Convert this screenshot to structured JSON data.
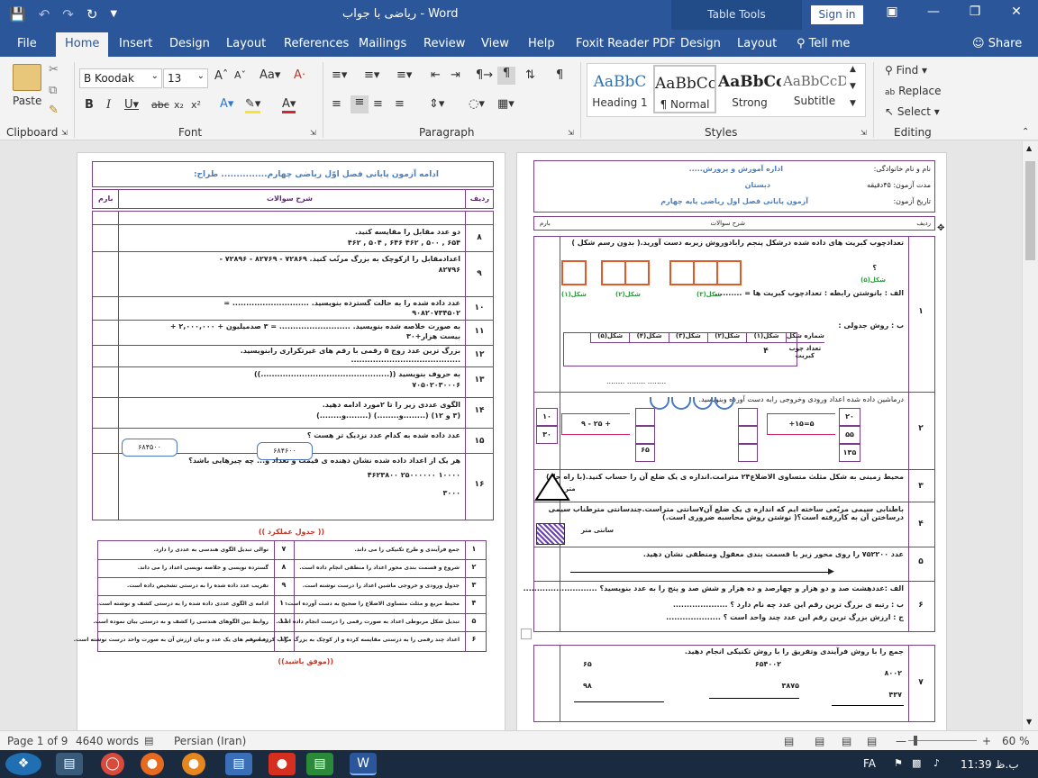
{
  "app": {
    "title": "ریاضی با جواب  -  Word",
    "context_tab": "Table Tools",
    "sign_in": "Sign in",
    "share": "Share",
    "tell_me": "Tell me"
  },
  "tabs": [
    "File",
    "Home",
    "Insert",
    "Design",
    "Layout",
    "References",
    "Mailings",
    "Review",
    "View",
    "Help",
    "Foxit Reader PDF",
    "Design",
    "Layout"
  ],
  "ribbon": {
    "paste": "Paste",
    "font_name": "B Koodak",
    "font_size": "13",
    "groups": {
      "clipboard": "Clipboard",
      "font": "Font",
      "paragraph": "Paragraph",
      "styles": "Styles",
      "editing": "Editing"
    },
    "styles": [
      {
        "sample": "AaBbC",
        "name": "Heading 1"
      },
      {
        "sample": "AaBbCcl",
        "name": "¶ Normal"
      },
      {
        "sample": "AaBbCc",
        "name": "Strong"
      },
      {
        "sample": "AaBbCcD",
        "name": "Subtitle"
      }
    ],
    "editing": {
      "find": "Find",
      "replace": "Replace",
      "select": "Select"
    }
  },
  "status": {
    "page": "Page 1 of 9",
    "words": "4640 words",
    "language": "Persian (Iran)",
    "zoom": "60 %"
  },
  "taskbar": {
    "lang": "FA",
    "time": "11:39 ب.ظ"
  },
  "left_page": {
    "title": "ادامه آزمون پایانی فصل اوّل ریاضی چهارم...............      طراح:",
    "col_row": "ردیف",
    "col_desc": "شرح سوالات",
    "col_score": "بارم",
    "questions": [
      {
        "n": "۸",
        "a": "دو عدد مقابل را مقایسه کنید.",
        "b": "۶۵۴ , ۵۰۰ , ۴۶۲     ۶۴۶ , ۵۰۴ , ۴۶۲"
      },
      {
        "n": "۹",
        "a": "اعدادمقابل را ازکوچک به بزرگ مرتّب کنید.   ۷۲۸۶۹  -  ۸۲۷۶۹  -  ۷۲۸۹۶  -",
        "b": "۸۲۷۹۶"
      },
      {
        "n": "۱۰",
        "a": "عدد داده شده را به حالت گسترده بنویسید. ............................ =",
        "b": "۹۰۸۲۰۷۳۴۵۰۲"
      },
      {
        "n": "۱۱",
        "a": "به صورت خلاصه شده بنویسید.    .......................... = ۳ صدمیلیون + ۲,۰۰۰,۰۰۰ +",
        "b": "بیست هزار+۳۰"
      },
      {
        "n": "۱۲",
        "a": "بزرگ ترین عدد زوج ۵ رقمی با رقم های غیرتکراری رابنویسید.",
        "b": "........................................"
      },
      {
        "n": "۱۳",
        "a": "به حروف بنویسید   ((...............................................))",
        "b": "۷۰۵۰۲۰۳۰۰۰۶"
      },
      {
        "n": "۱۴",
        "a": "الگوی عددی زیر را تا ۲مورد ادامه دهید.",
        "b": "(۳ و ۱۲)   (........و........)   (........و........)"
      },
      {
        "n": "۱۵",
        "a": "عدد داده شده به کدام عدد نزدیک تر هست ؟",
        "b": ""
      },
      {
        "n": "۱۶",
        "a": "هر یک از اعداد داده شده  نشان دهنده ی قیمت و تعداد و... چه چیزهایی باشد؟",
        "b": "۱۰۰۰۰          ۲۵۰۰۰۰۰۰          ۴۶۲۳۸۰۰"
      }
    ],
    "q15_options": [
      "۶۸۴۶۰۰",
      "۶۸۴۵۰۰"
    ],
    "q16_extra": "۳۰۰۰",
    "perf_title": "(( جدول عملکرد ))",
    "perf_rows": [
      {
        "n1": "۱",
        "t1": "جمع فرآیندی و طرح تکنیکی را می داند.",
        "n2": "۷",
        "t2": "توالی تبدیل الگوی هندسی به عددی را دارد."
      },
      {
        "n1": "۲",
        "t1": "شروع و قسمت بندی محور اعداد را منطقی انجام داده است.",
        "n2": "۸",
        "t2": "گسترده نویسی و خلاصه نویسی اعداد را می داند."
      },
      {
        "n1": "۳",
        "t1": "جدول ورودی و خروجی ماشین اعداد را درست نوشته است.",
        "n2": "۹",
        "t2": "تقریب عدد داده شده را به درستی تشخیص داده است."
      },
      {
        "n1": "۴",
        "t1": "محیط مربع و مثلث متساوی الاضلاع را صحیح به دست آورده است.",
        "n2": "۱۰",
        "t2": "ادامه ی الگوی عددی داده شده را به درستی کشف و نوشته است."
      },
      {
        "n1": "۵",
        "t1": "تبدیل شکل مربوطی اعداد به صورت رقمی را درست انجام داده است.",
        "n2": "۱۱",
        "t2": "روابط بین الگوهای هندسی را کشف و به درستی بیان نموده است."
      },
      {
        "n1": "۶",
        "t1": "اعداد چند رقمی را به درستی مقایسه کرده و از کوچک به بزرگ مرتب کرده است.",
        "n2": "۱۲",
        "t2": "رتبه رقم های یک عدد و بیان ارزش آن به صورت واحد درست نوشته است."
      }
    ],
    "good_luck": "((موفق باشید))"
  },
  "right_page": {
    "header_right": [
      "نام و نام خانوادگی:",
      "مدت آزمون: ۴۵دقیقه",
      "تاریخ آزمون:"
    ],
    "header_center": [
      "اداره آموزش و پرورش.....",
      "دبستان",
      "آزمون پایانی فصل اول ریاضی پایه چهارم"
    ],
    "col_row": "ردیف",
    "col_desc": "شرح سوالات",
    "col_score": "بارم",
    "q1": {
      "text": "تعدادچوب کبریت های داده شده درشکل پنجم رابادوروش زیربه دست آورید.( بدون رسم شکل )",
      "shape_labels": [
        "شکل(۱)",
        "شکل(۲)",
        "شکل(۳)"
      ],
      "shape5": "شکل(۵)",
      "q": "؟",
      "a": "الف : بانوشتن رابطه :           تعدادچوب کبریت ها = ..........",
      "b": "ب : روش جدولی :",
      "table_head": [
        "شماره شکل",
        "شکل(۱)",
        "شکل(۲)",
        "شکل(۳)",
        "شکل(۴)",
        "شکل(۵)"
      ],
      "table_row_label": "تعداد چوب کبریت",
      "table_val": "۴"
    },
    "q2": {
      "text": "درماشین داده شده اعداد ورودی وخروجی رابه دست آورده وبنویسید.",
      "in_left": [
        "۲۰",
        "۵۵",
        "۱۳۵"
      ],
      "op_left": "+۱۵=۵",
      "op_right": "۹ - ۲۵ +",
      "in_right": [
        "۱۰",
        "۳۰"
      ],
      "out_right": "۶۵"
    },
    "q3": "محیط زمینی به شکل مثلث متساوی الاضلاع۲۴ مترامت.اندازه ی یک ضلع آن را حساب کنید.(با راه حل)",
    "q3_unit": "متر",
    "q4": "باطنابی سیمی مربّعی ساخته ایم که اندازه ی یک ضلع آن۷سانتی متراست.چندسانتی مترطناب سیمی درساختن آن به کاررفته است؟( نوشتن روش محاسبه ضروری است.)",
    "q4_unit": "سانتی متر",
    "q5": "عدد ۷۵۲۲۰۰ را روی محور زیر با قسمت بندی معقول ومنطقی نشان دهید.",
    "q6": [
      "الف :عددهشت صد و دو هزار و چهارصد و ده هزار و شش صد و پنج را به عدد بنویسید؟ ...........................",
      "ب : رتبه ی بزرگ ترین رقم این عدد چه نام دارد ؟ ....................",
      "ج : ارزش بزرگ ترین رقم این عدد چند واحد است ؟ ...................."
    ],
    "q7": "جمع را با روش فرآیندی وتفریق را با روش تکنیکی انجام دهید.",
    "q7_nums": [
      "۶۵۴۰۰۲",
      "۳۸۷۵",
      "۸۰۰۲",
      "۴۳۷",
      "۶۵",
      "۹۸"
    ],
    "row_nums": [
      "۱",
      "۲",
      "۳",
      "۴",
      "۵",
      "۶",
      "۷"
    ]
  }
}
